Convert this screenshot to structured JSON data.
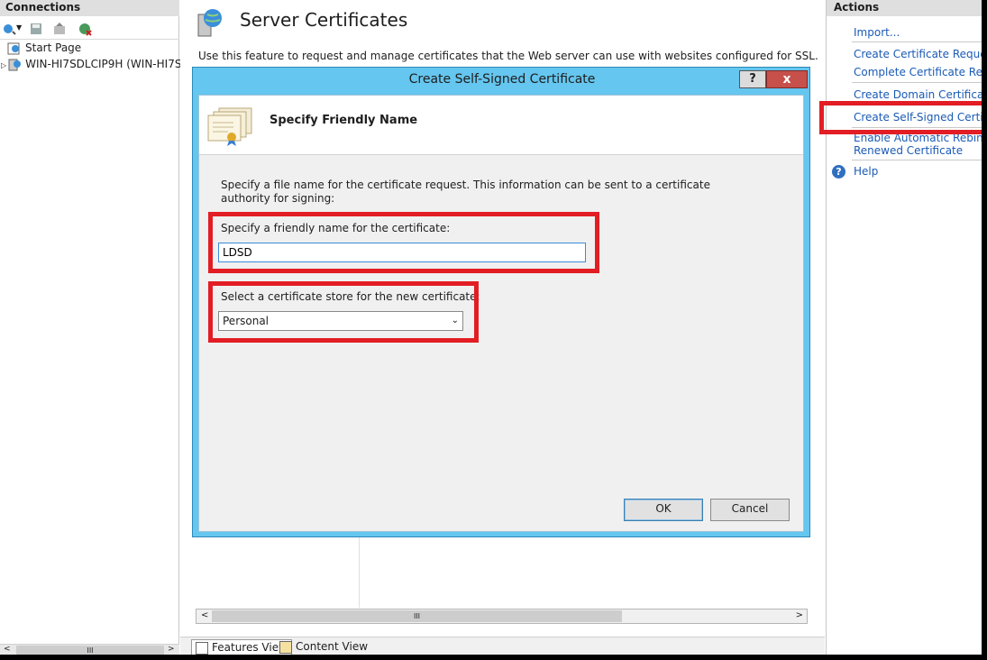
{
  "connections": {
    "title": "Connections",
    "tree": [
      {
        "label": "Start Page"
      },
      {
        "label": "WIN-HI7SDLCIP9H (WIN-HI7S"
      }
    ],
    "scroll_glyph": "III"
  },
  "center": {
    "title": "Server Certificates",
    "description": "Use this feature to request and manage certificates that the Web server can use with websites configured for SSL.",
    "scroll_glyph": "III",
    "tabs": [
      {
        "label": "Features View"
      },
      {
        "label": "Content View"
      }
    ]
  },
  "actions": {
    "title": "Actions",
    "items": [
      {
        "label": "Import..."
      },
      {
        "label": "Create Certificate Request..."
      },
      {
        "label": "Complete Certificate Request..."
      },
      {
        "label": "Create Domain Certificate..."
      },
      {
        "label": "Create Self-Signed Certificate..."
      },
      {
        "label": "Enable Automatic Rebind of"
      },
      {
        "label": "Renewed Certificate"
      },
      {
        "label": "Help"
      }
    ]
  },
  "dialog": {
    "title": "Create Self-Signed Certificate",
    "help_glyph": "?",
    "close_glyph": "x",
    "heading": "Specify Friendly Name",
    "intro": "Specify a file name for the certificate request.  This information can be sent to a certificate authority for signing:",
    "name_label": "Specify a friendly name for the certificate:",
    "name_value": "LDSD",
    "store_label": "Select a certificate store for the new certificate:",
    "store_value": "Personal",
    "ok_label": "OK",
    "cancel_label": "Cancel"
  },
  "colors": {
    "accent": "#65c6ef",
    "highlight": "#e21d24",
    "link": "#1a5ab6"
  }
}
